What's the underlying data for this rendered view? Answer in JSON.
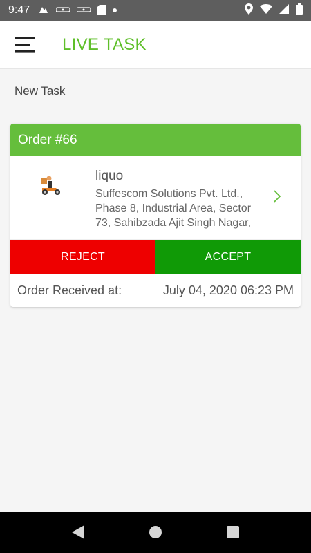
{
  "status_bar": {
    "time": "9:47",
    "left_icons": [
      "notification-icon",
      "apps-icon",
      "apps-icon-2",
      "sd-card-icon",
      "dot-icon"
    ],
    "right_icons": [
      "location-icon",
      "wifi-icon",
      "signal-icon",
      "battery-icon"
    ]
  },
  "app_bar": {
    "title": "LIVE TASK",
    "title_color": "#5fbf2a",
    "menu_icon": "hamburger-menu-icon"
  },
  "section": {
    "label": "New Task"
  },
  "order_card": {
    "header": "Order #66",
    "header_color": "#65be3c",
    "store_name": "liquo",
    "address": "Suffescom Solutions Pvt. Ltd., Phase 8, Industrial Area, Sector 73, Sahibzada Ajit Singh Nagar,",
    "thumbnail_icon": "delivery-scooter-icon",
    "chevron_icon": "chevron-right-icon",
    "reject_label": "REJECT",
    "reject_color": "#ee0000",
    "accept_label": "ACCEPT",
    "accept_color": "#109a06",
    "received_label": "Order Received at:",
    "received_value": "July 04, 2020 06:23 PM"
  },
  "nav_bar": {
    "buttons": [
      "back-icon",
      "home-icon",
      "recents-icon"
    ]
  }
}
